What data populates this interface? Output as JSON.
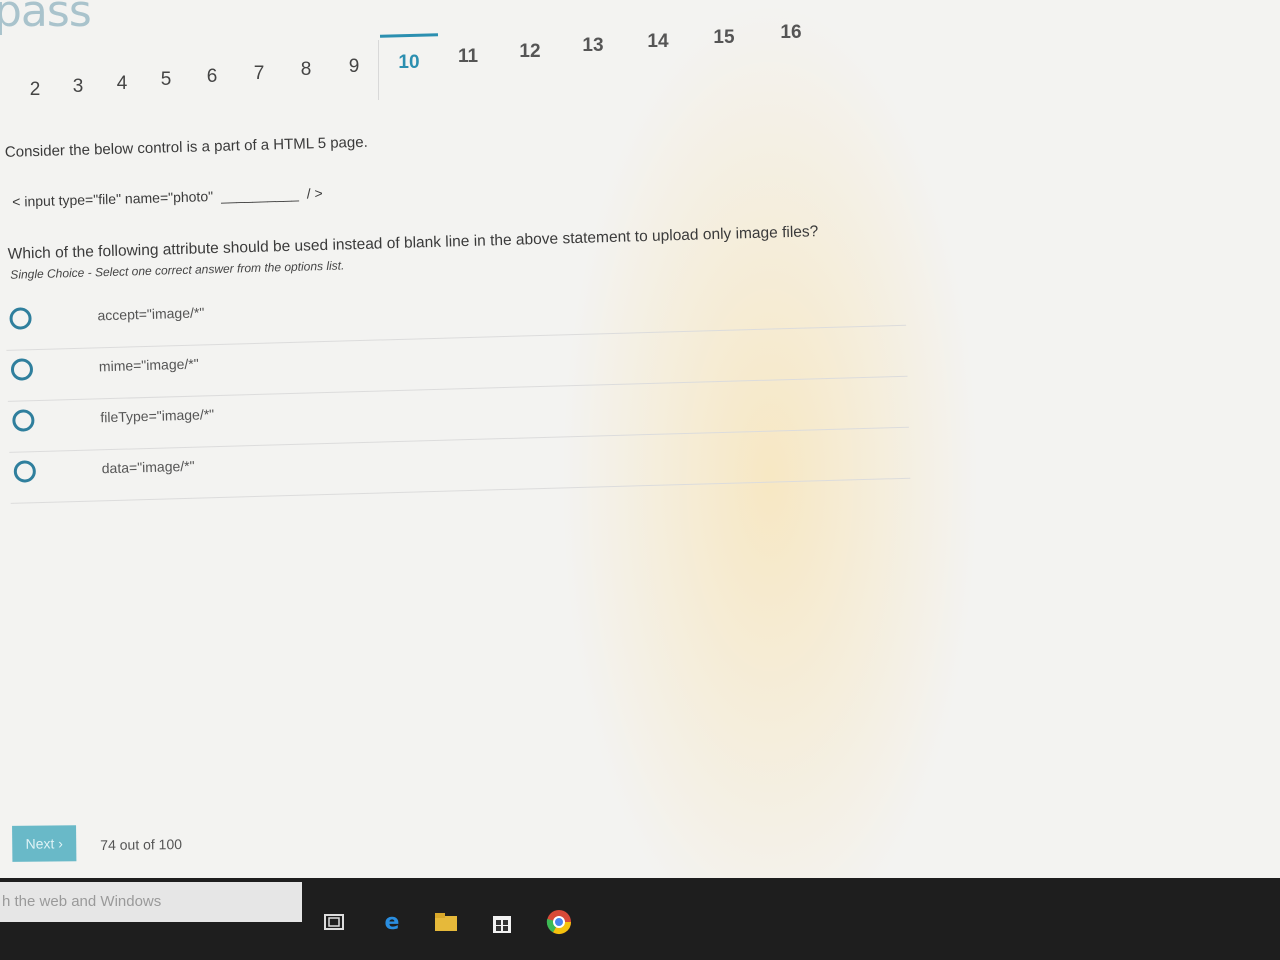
{
  "app": {
    "logo_text": "pass"
  },
  "question_nav": {
    "numbers": [
      "2",
      "3",
      "4",
      "5",
      "6",
      "7",
      "8",
      "9",
      "10",
      "11",
      "12",
      "13",
      "14",
      "15",
      "16"
    ],
    "current": "10"
  },
  "question": {
    "intro": "Consider the below control is a part of a HTML 5 page.",
    "code_prefix": "< input type=\"file\" name=\"photo\"",
    "code_blank": "__________",
    "code_suffix": "/ >",
    "prompt": "Which of the following attribute should be used instead of blank line in the above statement to upload only image files?",
    "hint": "Single Choice - Select one correct answer from the options list."
  },
  "options": [
    {
      "label": "accept=\"image/*\""
    },
    {
      "label": "mime=\"image/*\""
    },
    {
      "label": "fileType=\"image/*\""
    },
    {
      "label": "data=\"image/*\""
    }
  ],
  "footer": {
    "next_label": "Next ›",
    "progress_text": "74 out of 100"
  },
  "taskbar": {
    "search_placeholder": "h the web and Windows",
    "icons": [
      "task-view-icon",
      "edge-icon",
      "file-explorer-icon",
      "store-icon",
      "chrome-icon"
    ]
  },
  "colors": {
    "accent": "#2b8fb0",
    "button": "#69b9c8",
    "radio": "#2f7f9d"
  }
}
